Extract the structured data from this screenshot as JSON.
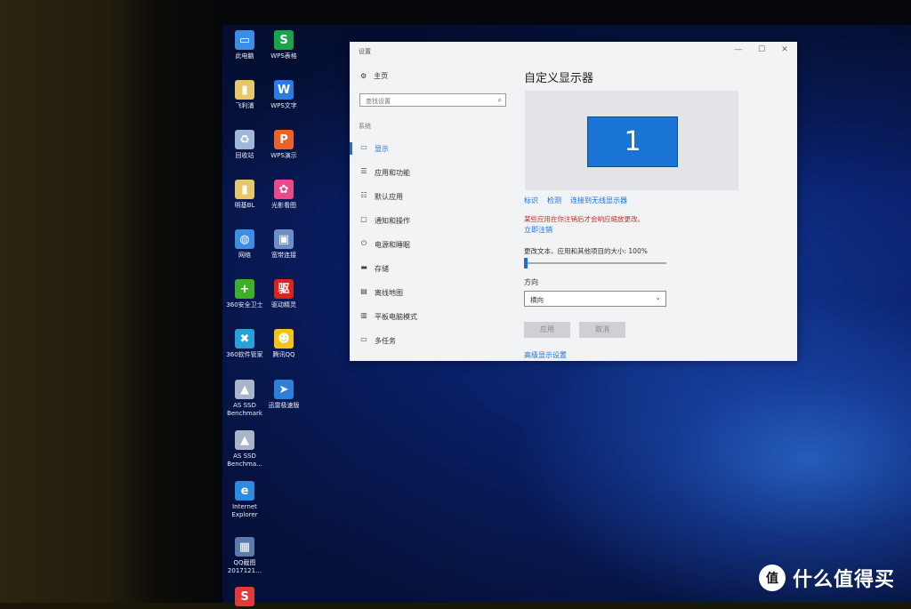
{
  "desktop_icons": [
    {
      "label": "此电脑",
      "icon": "computer-icon",
      "color": "#3a8ee6",
      "glyph": "▭"
    },
    {
      "label": "WPS表格",
      "icon": "wps-spreadsheet-icon",
      "color": "#1aa34a",
      "glyph": "S"
    },
    {
      "label": "飞利浦",
      "icon": "folder-icon",
      "color": "#e8c76a",
      "glyph": "▮"
    },
    {
      "label": "WPS文字",
      "icon": "wps-writer-icon",
      "color": "#2b7be4",
      "glyph": "W"
    },
    {
      "label": "回收站",
      "icon": "recycle-bin-icon",
      "color": "#9fb7d8",
      "glyph": "♻"
    },
    {
      "label": "WPS演示",
      "icon": "wps-presentation-icon",
      "color": "#e8622c",
      "glyph": "P"
    },
    {
      "label": "明基BL",
      "icon": "folder-icon",
      "color": "#e8c76a",
      "glyph": "▮"
    },
    {
      "label": "光影看图",
      "icon": "photo-viewer-icon",
      "color": "#e94b8a",
      "glyph": "✿"
    },
    {
      "label": "网络",
      "icon": "network-icon",
      "color": "#3a8ee6",
      "glyph": "◍"
    },
    {
      "label": "宽带连接",
      "icon": "broadband-icon",
      "color": "#6c8fc7",
      "glyph": "▣"
    },
    {
      "label": "360安全卫士",
      "icon": "security-360-icon",
      "color": "#3fae29",
      "glyph": "+"
    },
    {
      "label": "驱动精灵",
      "icon": "driver-genius-icon",
      "color": "#d9241c",
      "glyph": "驱"
    },
    {
      "label": "360软件管家",
      "icon": "software-manager-icon",
      "color": "#2aa0d8",
      "glyph": "✖"
    },
    {
      "label": "腾讯QQ",
      "icon": "qq-icon",
      "color": "#f2c21a",
      "glyph": "☻"
    },
    {
      "label": "AS SSD Benchmark",
      "icon": "ssd-benchmark-icon",
      "color": "#a9b4c8",
      "glyph": "▲"
    },
    {
      "label": "迅雷极速版",
      "icon": "thunder-icon",
      "color": "#2d7fd9",
      "glyph": "➤"
    },
    {
      "label": "AS SSD Benchma...",
      "icon": "ssd-benchmark-icon",
      "color": "#a9b4c8",
      "glyph": "▲"
    },
    {
      "label": "Internet Explorer",
      "icon": "ie-icon",
      "color": "#2b8be0",
      "glyph": "e"
    },
    {
      "label": "QQ截图 2017121…",
      "icon": "screenshot-icon",
      "color": "#5a7ab0",
      "glyph": "▦"
    },
    {
      "label": "",
      "icon": "app-icon",
      "color": "#e03a3a",
      "glyph": "S"
    }
  ],
  "window": {
    "title": "设置",
    "minimize": "—",
    "maximize": "☐",
    "close": "✕",
    "nav": {
      "home": "主页",
      "search_placeholder": "查找设置",
      "category": "系统",
      "items": [
        {
          "label": "显示",
          "icon": "display-icon",
          "glyph": "▭"
        },
        {
          "label": "应用和功能",
          "icon": "apps-icon",
          "glyph": "☰"
        },
        {
          "label": "默认应用",
          "icon": "default-apps-icon",
          "glyph": "☷"
        },
        {
          "label": "通知和操作",
          "icon": "notification-icon",
          "glyph": "▢"
        },
        {
          "label": "电源和睡眠",
          "icon": "power-icon",
          "glyph": "⏻"
        },
        {
          "label": "存储",
          "icon": "storage-icon",
          "glyph": "▬"
        },
        {
          "label": "离线地图",
          "icon": "map-icon",
          "glyph": "▤"
        },
        {
          "label": "平板电脑模式",
          "icon": "tablet-icon",
          "glyph": "▥"
        },
        {
          "label": "多任务",
          "icon": "multitask-icon",
          "glyph": "▭"
        }
      ]
    },
    "content": {
      "heading": "自定义显示器",
      "monitor_number": "1",
      "link_identify": "标识",
      "link_detect": "检测",
      "link_wireless": "连接到无线显示器",
      "warning": "某些应用在你注销后才会响应缩放更改。",
      "signout": "立即注销",
      "scale_label": "更改文本、应用和其他项目的大小: 100%",
      "scale_value": 0,
      "orientation_label": "方向",
      "orientation_value": "横向",
      "apply": "应用",
      "cancel": "取消",
      "advanced": "高级显示设置"
    }
  },
  "watermark": {
    "logo": "值",
    "text": "什么值得买"
  }
}
